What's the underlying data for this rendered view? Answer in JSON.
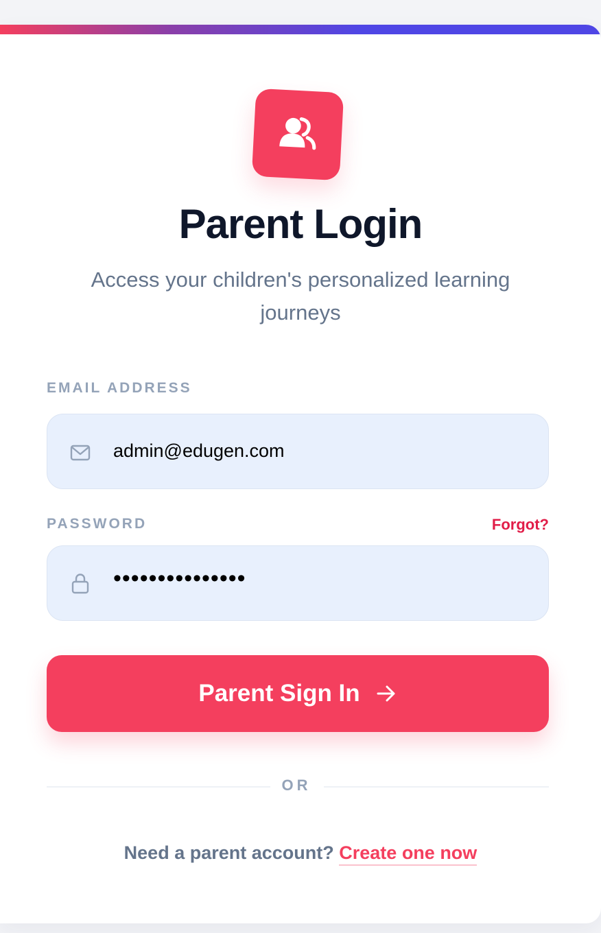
{
  "header": {
    "title": "Parent Login",
    "subtitle": "Access your children's personalized learning journeys",
    "logo_icon": "users-icon"
  },
  "form": {
    "email": {
      "label": "EMAIL ADDRESS",
      "value": "admin@edugen.com",
      "icon": "mail-icon"
    },
    "password": {
      "label": "PASSWORD",
      "value": "•••••••••••••••",
      "icon": "lock-icon",
      "forgot_label": "Forgot?"
    },
    "submit_label": "Parent Sign In",
    "submit_icon": "arrow-right-icon"
  },
  "divider": {
    "text": "OR"
  },
  "footer": {
    "prompt": "Need a parent account?",
    "link_label": "Create one now"
  },
  "colors": {
    "accent": "#f43f5e",
    "gradient_end": "#4f46e5",
    "input_bg": "#e8f0fd",
    "title": "#0f172a",
    "muted": "#94a3b8"
  }
}
